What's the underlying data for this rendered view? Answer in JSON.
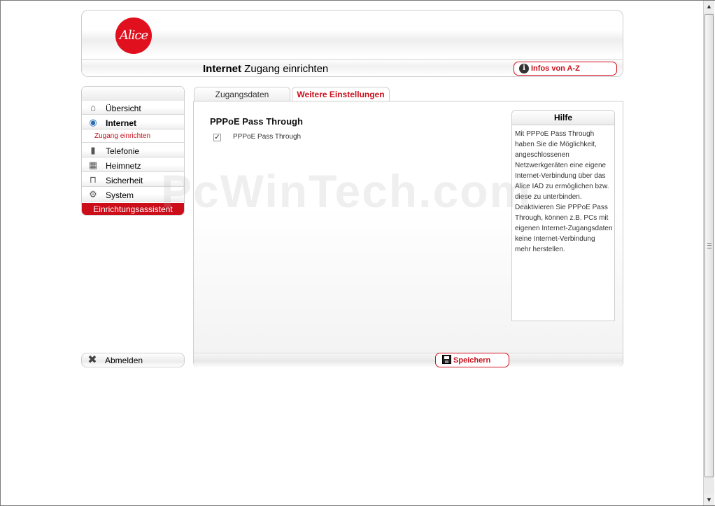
{
  "header": {
    "logo_text": "Alice",
    "title_bold": "Internet",
    "title_rest": " Zugang einrichten",
    "infos_button": "Infos von A-Z"
  },
  "sidebar": {
    "items": [
      {
        "label": "Übersicht",
        "icon": "home-icon"
      },
      {
        "label": "Internet",
        "icon": "globe-icon",
        "active": true
      },
      {
        "label": "Telefonie",
        "icon": "phone-icon"
      },
      {
        "label": "Heimnetz",
        "icon": "network-icon"
      },
      {
        "label": "Sicherheit",
        "icon": "lock-icon"
      },
      {
        "label": "System",
        "icon": "gear-icon"
      }
    ],
    "sub_item": "Zugang einrichten",
    "wizard": "Einrichtungsassistent",
    "logout": "Abmelden"
  },
  "tabs": [
    {
      "label": "Zugangsdaten",
      "active": false
    },
    {
      "label": "Weitere Einstellungen",
      "active": true
    }
  ],
  "main": {
    "section_title": "PPPoE Pass Through",
    "checkbox_label": "PPPoE Pass Through",
    "checkbox_checked": true,
    "save_button": "Speichern"
  },
  "help": {
    "title": "Hilfe",
    "text": "Mit PPPoE Pass Through haben Sie die Möglichkeit, angeschlossenen Netzwerkgeräten eine eigene Internet-Verbindung über das Alice IAD zu ermöglichen bzw. diese zu unterbinden. Deaktivieren Sie PPPoE Pass Through, können z.B. PCs mit eigenen Internet-Zugangsdaten keine Internet-Verbindung mehr herstellen."
  },
  "watermark": "PcWinTech.com",
  "colors": {
    "brand_red": "#cc0d1a",
    "border_gray": "#cfcfcf"
  }
}
